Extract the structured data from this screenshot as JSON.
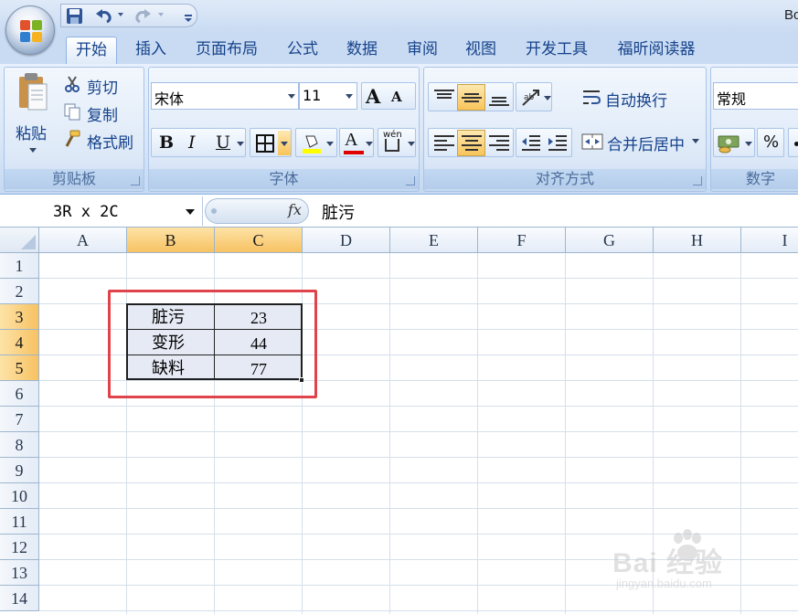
{
  "window": {
    "title": "Bo"
  },
  "qat": {
    "icons": [
      "save-icon",
      "undo-icon",
      "redo-icon",
      "customize-icon"
    ]
  },
  "tabs": [
    {
      "label": "开始",
      "active": true
    },
    {
      "label": "插入"
    },
    {
      "label": "页面布局"
    },
    {
      "label": "公式"
    },
    {
      "label": "数据"
    },
    {
      "label": "审阅"
    },
    {
      "label": "视图"
    },
    {
      "label": "开发工具"
    },
    {
      "label": "福昕阅读器"
    }
  ],
  "ribbon": {
    "clipboard": {
      "label": "剪贴板",
      "paste": "粘贴",
      "cut": "剪切",
      "copy": "复制",
      "format_painter": "格式刷"
    },
    "font": {
      "label": "字体",
      "font_name": "宋体",
      "font_size": "11",
      "bold": "B",
      "italic": "I",
      "underline": "U",
      "font_color_letter": "A",
      "grow": "A",
      "shrink": "A",
      "phonetic": "wén"
    },
    "alignment": {
      "label": "对齐方式",
      "wrap_text": "自动换行",
      "merge_center": "合并后居中"
    },
    "number": {
      "label": "数字",
      "format": "常规",
      "percent": "%"
    }
  },
  "formula_bar": {
    "name_box": "3R x 2C",
    "fx": "fx",
    "content": "脏污"
  },
  "sheet": {
    "columns": [
      "A",
      "B",
      "C",
      "D",
      "E",
      "F",
      "G",
      "H",
      "I"
    ],
    "selected_columns": [
      "B",
      "C"
    ],
    "rows": [
      "1",
      "2",
      "3",
      "4",
      "5",
      "6",
      "7",
      "8",
      "9",
      "10",
      "11",
      "12",
      "13",
      "14"
    ],
    "selected_rows": [
      "3",
      "4",
      "5"
    ],
    "table": [
      {
        "label": "脏污",
        "value": "23"
      },
      {
        "label": "变形",
        "value": "44"
      },
      {
        "label": "缺料",
        "value": "77"
      }
    ]
  },
  "watermark": {
    "brand": "Bai 经验",
    "url": "jingyan.baidu.com"
  },
  "colors": {
    "selected_header": "#f7c262",
    "highlight_box": "#e0434a",
    "ribbon_text": "#15428b"
  }
}
